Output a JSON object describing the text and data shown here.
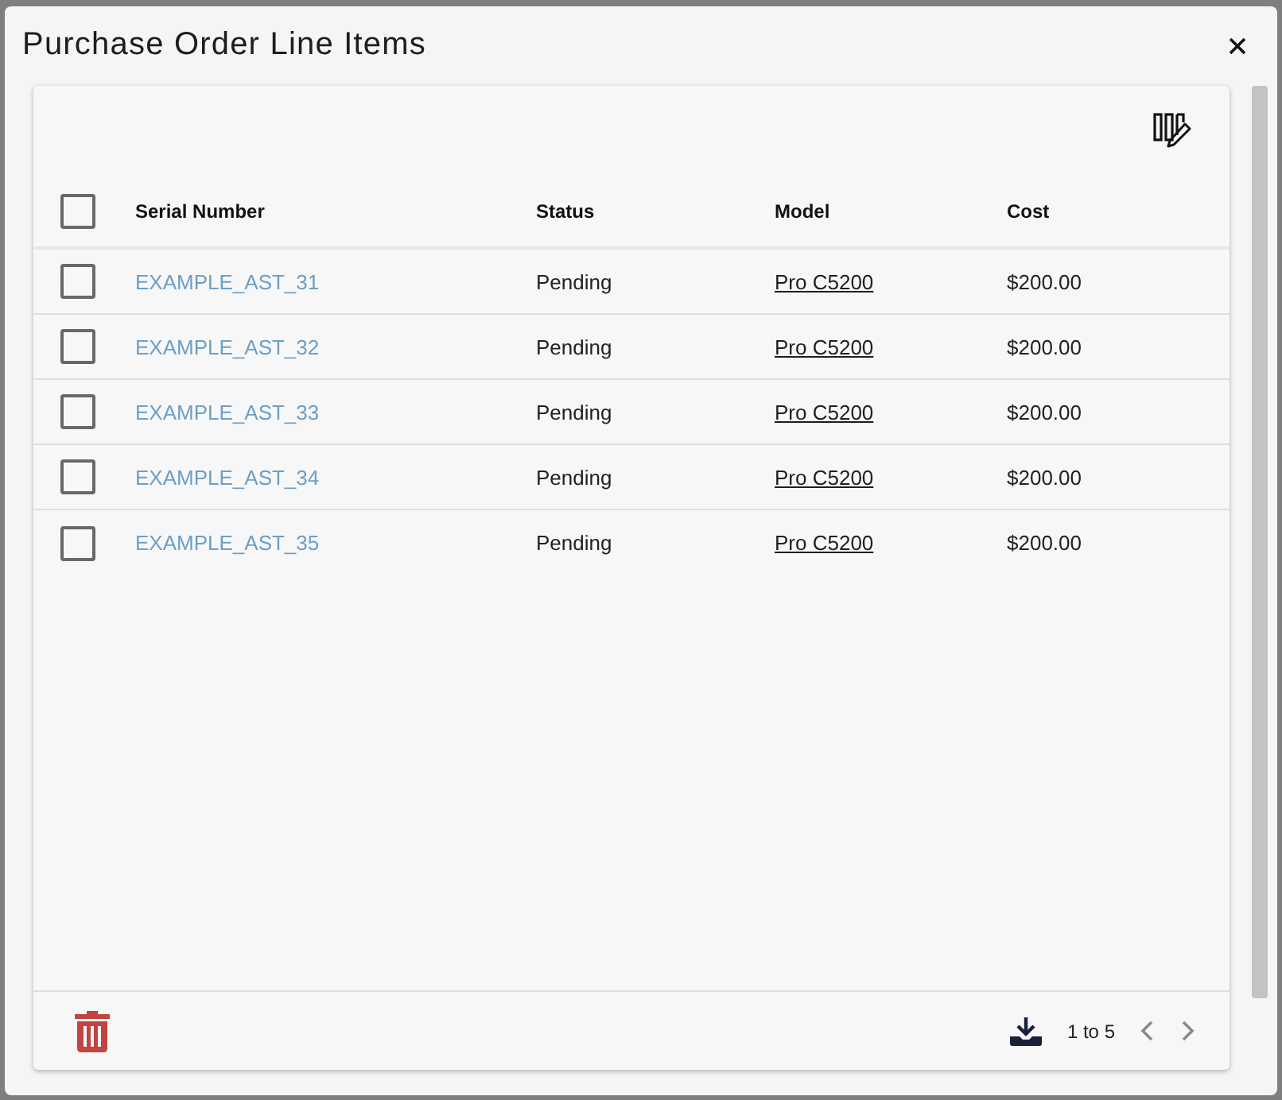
{
  "dialog": {
    "title": "Purchase Order Line Items"
  },
  "table": {
    "select_all": {
      "checked": false
    },
    "columns": [
      {
        "label": "Serial Number"
      },
      {
        "label": "Status"
      },
      {
        "label": "Model"
      },
      {
        "label": "Cost"
      }
    ],
    "rows": [
      {
        "checked": false,
        "serial_number": "EXAMPLE_AST_31",
        "status": "Pending",
        "model": "Pro C5200",
        "cost": "$200.00"
      },
      {
        "checked": false,
        "serial_number": "EXAMPLE_AST_32",
        "status": "Pending",
        "model": "Pro C5200",
        "cost": "$200.00"
      },
      {
        "checked": false,
        "serial_number": "EXAMPLE_AST_33",
        "status": "Pending",
        "model": "Pro C5200",
        "cost": "$200.00"
      },
      {
        "checked": false,
        "serial_number": "EXAMPLE_AST_34",
        "status": "Pending",
        "model": "Pro C5200",
        "cost": "$200.00"
      },
      {
        "checked": false,
        "serial_number": "EXAMPLE_AST_35",
        "status": "Pending",
        "model": "Pro C5200",
        "cost": "$200.00"
      }
    ]
  },
  "footer": {
    "range": "1 to 5"
  }
}
